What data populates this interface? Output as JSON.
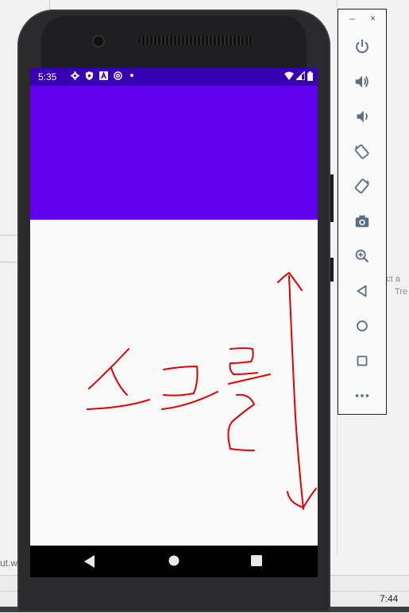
{
  "ide": {
    "right_text_1": "ect a",
    "right_text_2": "Tre",
    "left_text": "ut.w",
    "clock": "7:44"
  },
  "status_bar": {
    "time": "5:35",
    "left_icons": [
      "gear-icon",
      "shield-icon",
      "a-icon",
      "at-icon",
      "dot-icon"
    ],
    "right_icons": [
      "wifi-icon",
      "signal-icon",
      "battery-icon"
    ]
  },
  "colors": {
    "status_bar": "#3700b3",
    "app_bar": "#6200ee",
    "drawing": "#e00000"
  },
  "annotation": {
    "handwritten_text": "스크롤"
  },
  "emulator_toolbar": {
    "minimize": "–",
    "close": "×",
    "buttons": [
      "power",
      "volume-up",
      "volume-down",
      "rotate-left",
      "rotate-right",
      "screenshot",
      "zoom",
      "back",
      "home",
      "overview",
      "more"
    ]
  }
}
